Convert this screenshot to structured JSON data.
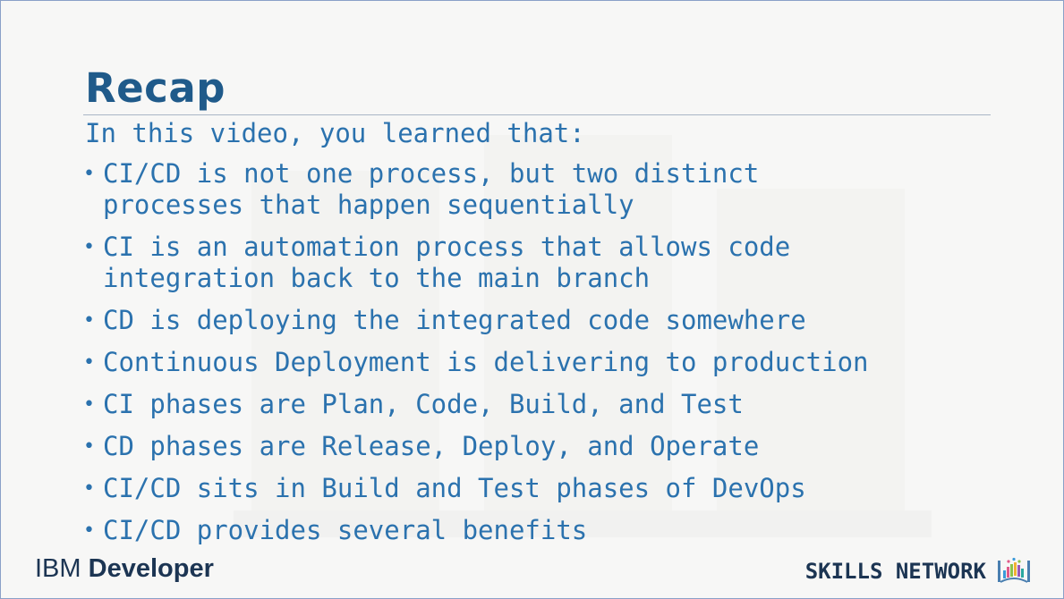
{
  "slide": {
    "title": "Recap",
    "intro": "In this video, you learned that:",
    "bullets": [
      {
        "lines": [
          "CI/CD is not one process, but two distinct",
          "processes that happen sequentially"
        ]
      },
      {
        "lines": [
          "CI is an automation process that allows code",
          "integration back to the main branch"
        ]
      },
      {
        "lines": [
          "CD is deploying the integrated code somewhere"
        ]
      },
      {
        "lines": [
          "Continuous Deployment is delivering to production"
        ]
      },
      {
        "lines": [
          "CI phases are Plan, Code, Build, and Test"
        ]
      },
      {
        "lines": [
          "CD phases are Release, Deploy, and Operate"
        ]
      },
      {
        "lines": [
          "CI/CD sits in Build and Test phases of DevOps"
        ]
      },
      {
        "lines": [
          "CI/CD provides several benefits"
        ]
      }
    ]
  },
  "footer": {
    "ibm_part": "IBM",
    "developer_part": "Developer",
    "skills_network": "SKILLS NETWORK"
  },
  "icons": {
    "bullet": "bullet-dot-icon",
    "skills_network": "book-icon",
    "watermark": "watermark-graphic-icon"
  },
  "colors": {
    "title": "#1f5a8a",
    "body_text": "#2b72ae",
    "logo_text": "#1c3553",
    "background": "#f7f7f6"
  }
}
